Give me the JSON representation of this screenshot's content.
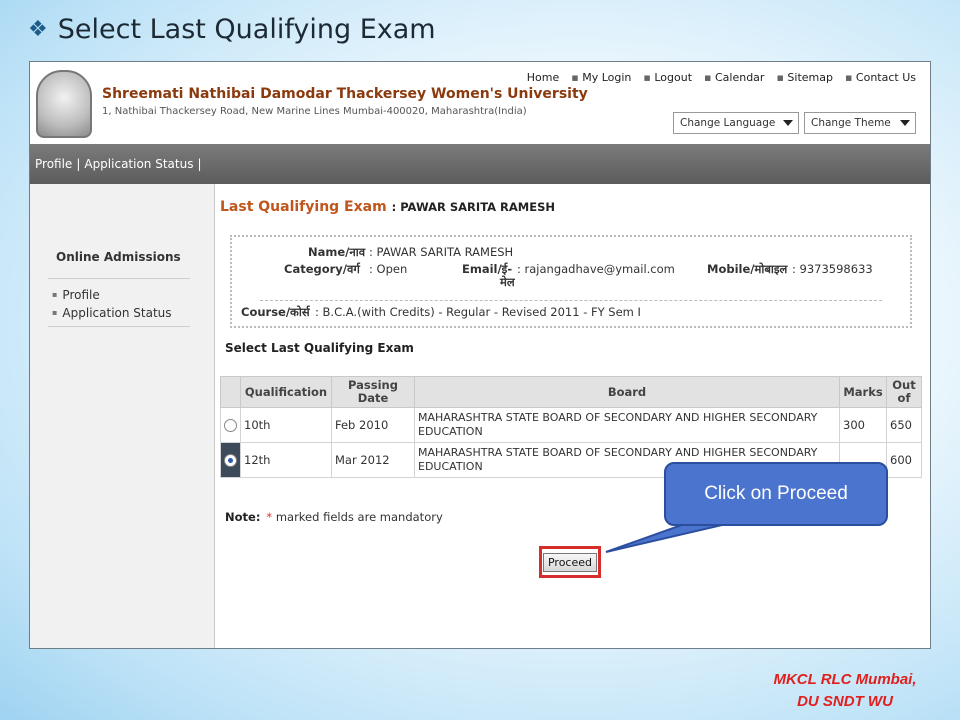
{
  "slide": {
    "title": "Select Last Qualifying Exam",
    "callout": "Click on Proceed",
    "footer_line1": "MKCL RLC Mumbai,",
    "footer_line2": "DU SNDT WU"
  },
  "site": {
    "university_name": "Shreemati Nathibai Damodar Thackersey Women's University",
    "address": "1, Nathibai Thackersey Road, New Marine Lines Mumbai-400020, Maharashtra(India)",
    "top_links": [
      "Home",
      "My Login",
      "Logout",
      "Calendar",
      "Sitemap",
      "Contact Us"
    ],
    "change_language": "Change Language",
    "change_theme": "Change Theme"
  },
  "navbar": {
    "items": [
      "Profile",
      "Application Status"
    ]
  },
  "sidebar": {
    "heading": "Online Admissions",
    "items": [
      "Profile",
      "Application Status"
    ]
  },
  "page": {
    "heading": "Last Qualifying Exam",
    "heading_sep": ":",
    "student": "PAWAR SARITA RAMESH"
  },
  "info": {
    "name_label": "Name/नाव",
    "name_value": "PAWAR SARITA RAMESH",
    "category_label": "Category/वर्ग",
    "category_value": "Open",
    "email_label": "Email/ई-",
    "email_label_2": "मेल",
    "email_value": "rajangadhave@ymail.com",
    "mobile_label": "Mobile/मोबाइल",
    "mobile_value": "9373598633",
    "course_label": "Course/कोर्स",
    "course_value": "B.C.A.(with Credits) - Regular - Revised 2011 - FY Sem I",
    "colon": ":"
  },
  "exam": {
    "section_title": "Select Last Qualifying Exam",
    "headers": {
      "qualification": "Qualification",
      "passing_1": "Passing",
      "passing_2": "Date",
      "board": "Board",
      "marks": "Marks",
      "outof_1": "Out",
      "outof_2": "of"
    },
    "rows": [
      {
        "qualification": "10th",
        "passing_date": "Feb 2010",
        "board_1": "MAHARASHTRA STATE BOARD OF SECONDARY AND HIGHER SECONDARY",
        "board_2": "EDUCATION",
        "marks": "300",
        "out_of": "650",
        "selected": false
      },
      {
        "qualification": "12th",
        "passing_date": "Mar 2012",
        "board_1": "MAHARASHTRA STATE BOARD OF SECONDARY AND HIGHER SECONDARY",
        "board_2": "EDUCATION",
        "marks": "",
        "out_of": "600",
        "selected": true
      }
    ]
  },
  "note": {
    "label": "Note:",
    "star": "*",
    "text": "marked fields are mandatory"
  },
  "proceed_label": "Proceed",
  "colors": {
    "university_name": "#8b3a0e",
    "page_heading": "#c0561c",
    "callout_bg": "#4a74cd",
    "highlight_border": "#d72d2d",
    "footer_credit": "#e0201e"
  },
  "icons": [
    "diamond-bullet-icon",
    "university-logo",
    "dropdown-arrow-icon",
    "radio-icon"
  ]
}
